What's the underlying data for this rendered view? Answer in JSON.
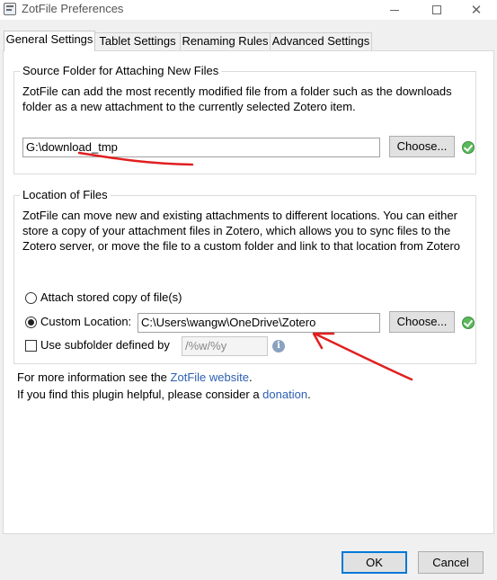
{
  "window": {
    "title": "ZotFile Preferences",
    "close_glyph": "✕"
  },
  "tabs": [
    {
      "label": "General Settings",
      "active": true
    },
    {
      "label": "Tablet Settings",
      "active": false
    },
    {
      "label": "Renaming Rules",
      "active": false
    },
    {
      "label": "Advanced Settings",
      "active": false
    }
  ],
  "source_folder": {
    "legend": "Source Folder for Attaching New Files",
    "description": "ZotFile can add the most recently modified file from a folder such as the downloads folder as a new attachment to the currently selected Zotero item.",
    "path_value": "G:\\download_tmp",
    "choose_label": "Choose...",
    "status_icon": "check-circle-icon"
  },
  "location": {
    "legend": "Location of Files",
    "description": "ZotFile can move new and existing attachments to different locations. You can either store a copy of your attachment files in Zotero, which allows you to sync files to the Zotero server, or move the file to a custom folder and link to that location from Zotero",
    "option_attach_label": "Attach stored copy of file(s)",
    "option_attach_checked": false,
    "option_custom_label": "Custom Location:",
    "option_custom_checked": true,
    "custom_path_value": "C:\\Users\\wangw\\OneDrive\\Zotero",
    "choose_label": "Choose...",
    "status_icon": "check-circle-icon",
    "subfolder_label": "Use subfolder defined by",
    "subfolder_checked": false,
    "subfolder_pattern": "/%w/%y",
    "info_icon": "info-icon",
    "info_glyph": "i"
  },
  "info": {
    "more_info_prefix": "For more information see the ",
    "website_link": "ZotFile website",
    "more_info_suffix": ".",
    "helpful_prefix": "If you find this plugin helpful, please consider a ",
    "donation_link": "donation",
    "helpful_suffix": "."
  },
  "footer": {
    "ok_label": "OK",
    "cancel_label": "Cancel"
  },
  "annotation_color": "#e02020"
}
